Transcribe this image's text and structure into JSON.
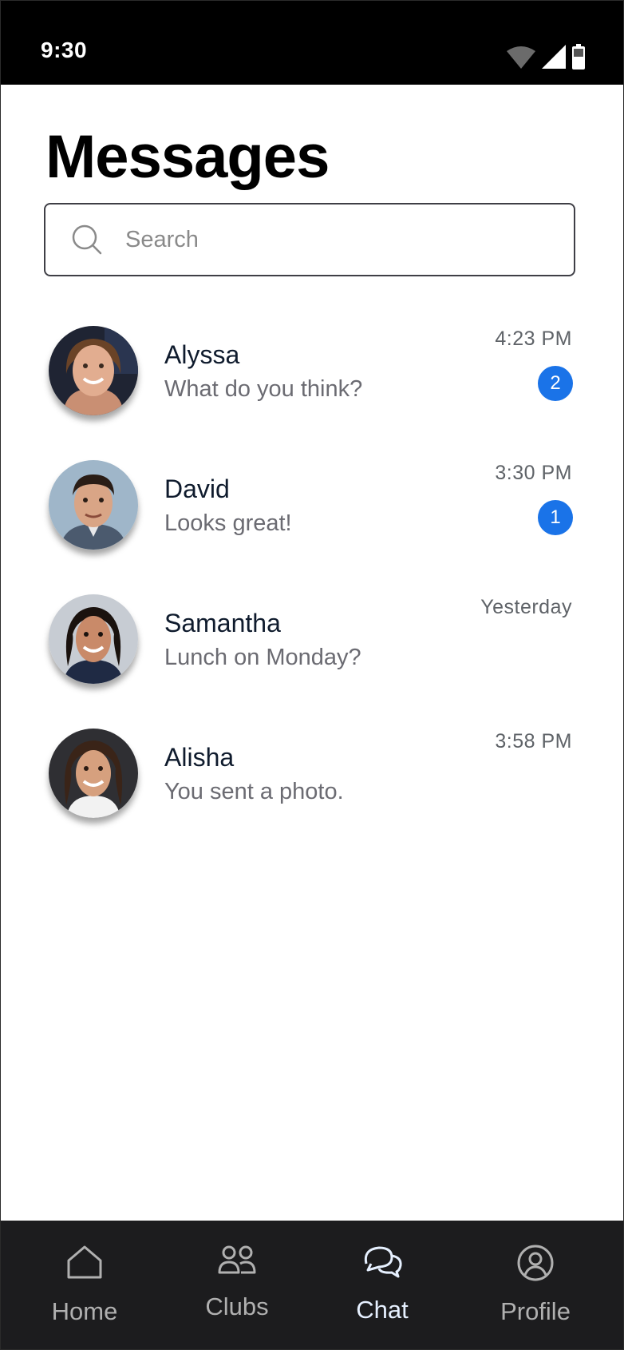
{
  "status_bar": {
    "time": "9:30"
  },
  "page": {
    "title": "Messages"
  },
  "search": {
    "placeholder": "Search"
  },
  "conversations": [
    {
      "name": "Alyssa",
      "preview": "What do you think?",
      "time": "4:23 PM",
      "unread": "2"
    },
    {
      "name": "David",
      "preview": "Looks great!",
      "time": "3:30 PM",
      "unread": "1"
    },
    {
      "name": "Samantha",
      "preview": "Lunch on Monday?",
      "time": "Yesterday"
    },
    {
      "name": "Alisha",
      "preview": "You sent a photo.",
      "time": "3:58 PM"
    }
  ],
  "nav": {
    "items": [
      {
        "label": "Home",
        "icon": "home-icon"
      },
      {
        "label": "Clubs",
        "icon": "people-icon"
      },
      {
        "label": "Chat",
        "icon": "chat-icon",
        "active": true
      },
      {
        "label": "Profile",
        "icon": "profile-icon"
      }
    ]
  },
  "colors": {
    "accent": "#1a73e8",
    "nav_bg": "#1c1c1e",
    "status_bar_bg": "#000000"
  }
}
